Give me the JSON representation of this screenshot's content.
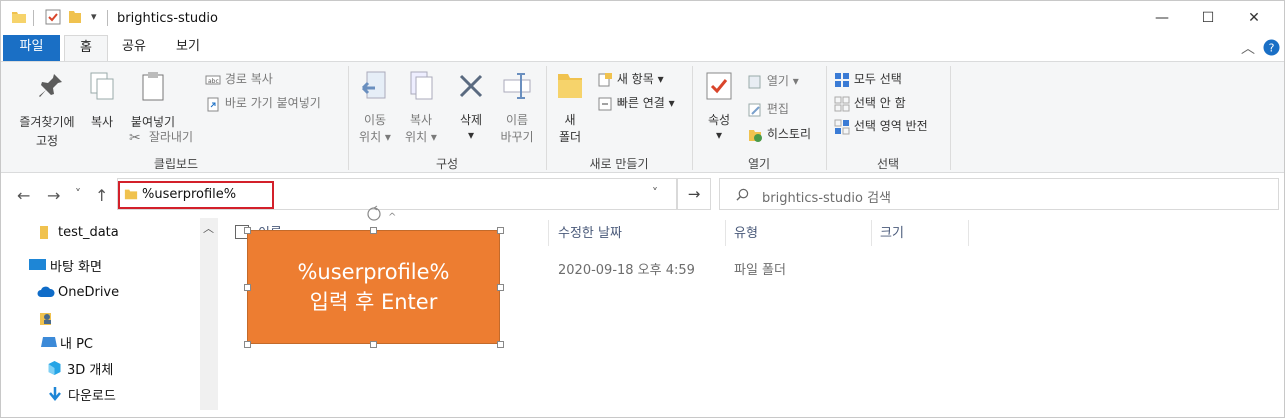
{
  "window": {
    "title": "brightics-studio",
    "minimize": "—",
    "maximize": "☐",
    "close": "✕"
  },
  "ribbon_tabs": [
    "파일",
    "홈",
    "공유",
    "보기"
  ],
  "ribbon": {
    "clipboard": {
      "pin_line1": "즐겨찾기에",
      "pin_line2": "고정",
      "copy": "복사",
      "paste": "붙여넣기",
      "copy_path": "경로 복사",
      "paste_shortcut": "바로 가기 붙여넣기",
      "cut": "잘라내기",
      "group_label": "클립보드"
    },
    "organize": {
      "move_line1": "이동",
      "move_line2": "위치 ▾",
      "copyto_line1": "복사",
      "copyto_line2": "위치 ▾",
      "delete_line1": "삭제",
      "delete_line2": "▾",
      "rename_line1": "이름",
      "rename_line2": "바꾸기",
      "group_label": "구성"
    },
    "new": {
      "folder_line1": "새",
      "folder_line2": "폴더",
      "new_item": "새 항목 ▾",
      "easy_access": "빠른 연결 ▾",
      "group_label": "새로 만들기"
    },
    "open": {
      "properties_line1": "속성",
      "properties_line2": "▾",
      "open": "열기 ▾",
      "edit": "편집",
      "history": "히스토리",
      "group_label": "열기"
    },
    "select": {
      "select_all": "모두 선택",
      "select_none": "선택 안 함",
      "invert": "선택 영역 반전",
      "group_label": "선택"
    }
  },
  "nav": {
    "back": "←",
    "forward": "→",
    "recent": "˅",
    "up": "↑",
    "address_value": "%userprofile%",
    "dropdown": "˅",
    "go": "→",
    "search_placeholder": "brightics-studio 검색"
  },
  "navpane": [
    {
      "label": "test_data",
      "icon": "folder-icon"
    },
    {
      "label": "바탕 화면",
      "icon": "desktop-icon"
    },
    {
      "label": "OneDrive",
      "icon": "onedrive-icon"
    },
    {
      "label": "",
      "icon": "user-folder-icon"
    },
    {
      "label": "내 PC",
      "icon": "pc-icon"
    },
    {
      "label": "3D 개체",
      "icon": "3d-objects-icon"
    },
    {
      "label": "다운로드",
      "icon": "download-icon"
    }
  ],
  "file_list": {
    "columns": [
      "이름",
      "수정한 날짜",
      "유형",
      "크기"
    ],
    "rows": [
      {
        "modified": "2020-09-18 오후 4:59",
        "type": "파일 폴더"
      }
    ]
  },
  "callout": {
    "line1": "%userprofile%",
    "line2": "입력 후 Enter"
  },
  "colors": {
    "file_tab": "#1a6fc5",
    "callout": "#ed7d31",
    "highlight_border": "#d3202a",
    "folder": "#f0c24f"
  }
}
